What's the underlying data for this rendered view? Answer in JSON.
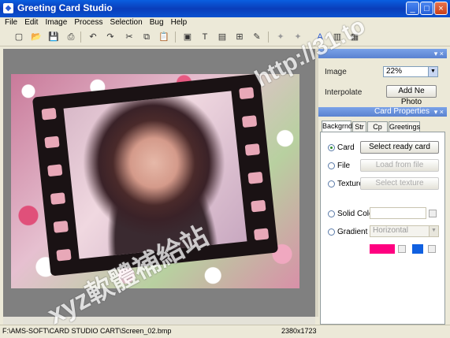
{
  "window": {
    "title": "Greeting Card Studio",
    "icon": "app-icon",
    "controls": [
      "_",
      "□",
      "×"
    ]
  },
  "menu": [
    "File",
    "Edit",
    "Image",
    "Process",
    "Selection",
    "Bug",
    "Help"
  ],
  "toolbar_icons": [
    "new-icon",
    "open-icon",
    "save-icon",
    "print-icon",
    "undo-icon",
    "redo-icon",
    "cut-icon",
    "copy-icon",
    "paste-icon",
    "image-icon",
    "text-icon",
    "page-icon",
    "frame-icon",
    "brush-icon",
    "rotate-left-icon",
    "rotate-right-icon",
    "font-icon",
    "export-icon",
    "doc-icon"
  ],
  "toolbar_glyphs": [
    "▢",
    "📂",
    "💾",
    "⎙",
    "↶",
    "↷",
    "✂",
    "⧉",
    "📋",
    "▣",
    "T",
    "▤",
    "⊞",
    "✎",
    "✦",
    "✦",
    "A",
    "▥",
    "▦"
  ],
  "image_panel": {
    "zoom_label": "Image",
    "zoom_value": "22%",
    "interpolate_label": "Interpolate",
    "add_photo_label": "Add Ne Photo",
    "panel_buttons": "▾ ×"
  },
  "card_properties": {
    "title": "Card Properties",
    "panel_buttons": "▾ ×",
    "tabs": [
      "Backgrnd",
      "Str",
      "Cp Art",
      "Greetings"
    ],
    "options": {
      "card": {
        "label": "Card",
        "button": "Select ready card"
      },
      "file": {
        "label": "File",
        "button": "Load from file"
      },
      "texture": {
        "label": "Texture",
        "button": "Select texture"
      },
      "solid": {
        "label": "Solid Color"
      },
      "gradient": {
        "label": "Gradient",
        "mode": "Horizontal"
      }
    },
    "gradient_colors": [
      "#FF0080",
      "#1060E0"
    ]
  },
  "status": {
    "path": "F:\\AMS-SOFT\\CARD STUDIO CART\\Screen_02.bmp",
    "size": "2380x1723"
  },
  "watermarks": {
    "url": "http://31.to",
    "site": "xyz軟體補給站"
  }
}
